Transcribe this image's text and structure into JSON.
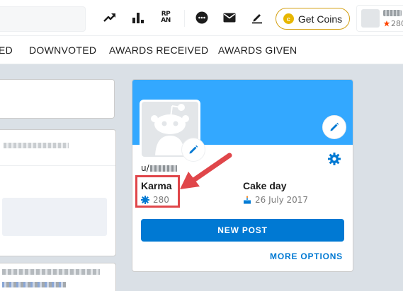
{
  "header": {
    "icons": [
      "trending-icon",
      "leaderboard-icon",
      "rpan-icon",
      "chat-icon",
      "mail-icon",
      "create-post-icon"
    ],
    "rpan_label": "RP\nAN",
    "get_coins_label": "Get Coins",
    "user_karma": "280"
  },
  "tabs": [
    {
      "label": "ED"
    },
    {
      "label": "DOWNVOTED"
    },
    {
      "label": "AWARDS RECEIVED"
    },
    {
      "label": "AWARDS GIVEN"
    }
  ],
  "profile": {
    "username_prefix": "u/",
    "karma_label": "Karma",
    "karma_value": "280",
    "cake_day_label": "Cake day",
    "cake_day_value": "26 July 2017",
    "new_post_label": "NEW POST",
    "more_options_label": "MORE OPTIONS"
  },
  "colors": {
    "banner": "#33a8ff",
    "primary_blue": "#0079d3",
    "highlight_red": "#e0464a",
    "coin_gold": "#e7b600"
  }
}
